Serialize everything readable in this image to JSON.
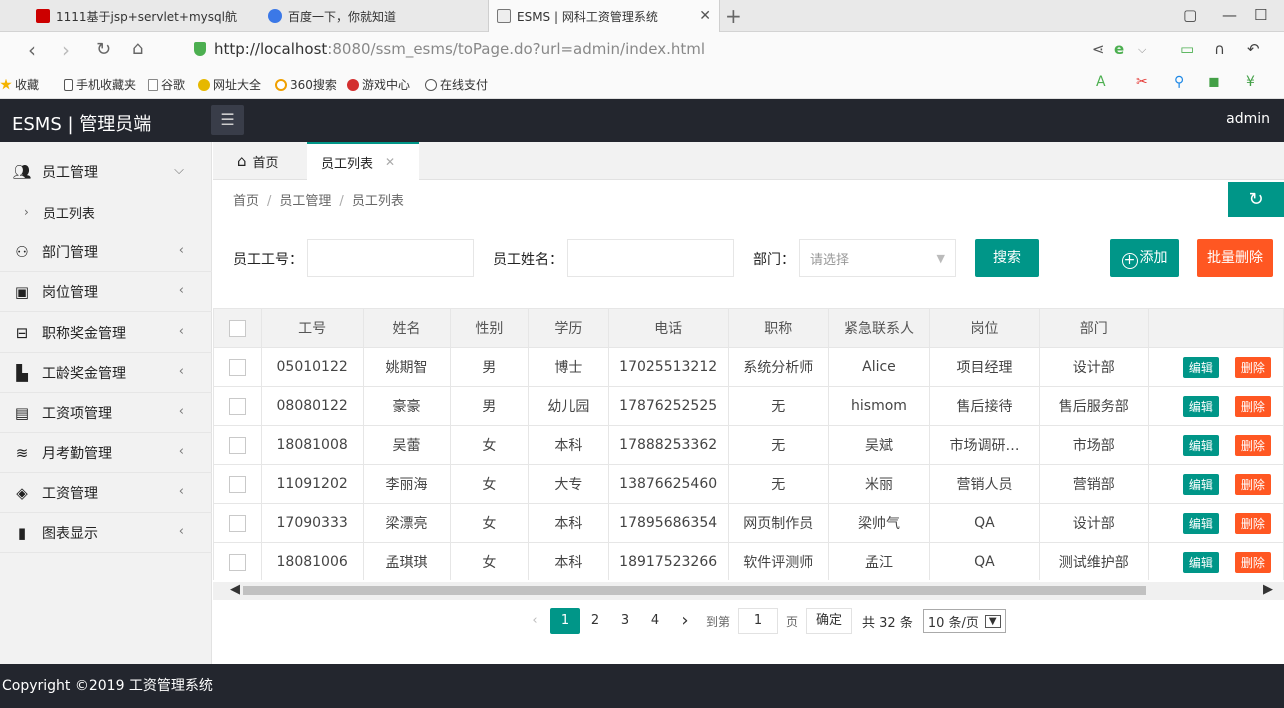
{
  "browser": {
    "tabs": [
      {
        "title": "1111基于jsp+servlet+mysql航",
        "active": false
      },
      {
        "title": "百度一下，你就知道",
        "active": false
      },
      {
        "title": "ESMS | 网科工资管理系统",
        "active": true
      }
    ],
    "url_host": "http://localhost",
    "url_rest": ":8080/ssm_esms/toPage.do?url=admin/index.html",
    "bookmarks": [
      "收藏",
      "手机收藏夹",
      "谷歌",
      "网址大全",
      "360搜索",
      "游戏中心",
      "在线支付"
    ]
  },
  "app": {
    "title": "ESMS | 管理员端",
    "user": "admin",
    "footer": "Copyright ©2019 工资管理系统"
  },
  "sidebar": {
    "items": [
      {
        "label": "员工管理",
        "icon": "users-icon",
        "expanded": true
      },
      {
        "label": "部门管理",
        "icon": "org-chart-icon"
      },
      {
        "label": "岗位管理",
        "icon": "id-card-icon"
      },
      {
        "label": "职称奖金管理",
        "icon": "briefcase-icon"
      },
      {
        "label": "工龄奖金管理",
        "icon": "factory-icon"
      },
      {
        "label": "工资项管理",
        "icon": "salary-item-icon"
      },
      {
        "label": "月考勤管理",
        "icon": "layers-icon"
      },
      {
        "label": "工资管理",
        "icon": "tag-icon"
      },
      {
        "label": "图表显示",
        "icon": "document-icon"
      }
    ],
    "subitems": [
      {
        "label": "员工列表"
      }
    ]
  },
  "page_tabs": [
    {
      "label": "首页"
    },
    {
      "label": "员工列表"
    }
  ],
  "breadcrumb": [
    "首页",
    "员工管理",
    "员工列表"
  ],
  "filters": {
    "emp_no_label": "员工工号：",
    "emp_name_label": "员工姓名：",
    "dept_label": "部门：",
    "dept_placeholder": "请选择",
    "search_label": "搜索",
    "add_label": "添加",
    "batch_delete_label": "批量删除"
  },
  "table": {
    "headers": [
      "工号",
      "姓名",
      "性别",
      "学历",
      "电话",
      "职称",
      "紧急联系人",
      "岗位",
      "部门"
    ],
    "edit_label": "编辑",
    "delete_label": "删除",
    "rows": [
      [
        "05010122",
        "姚期智",
        "男",
        "博士",
        "17025513212",
        "系统分析师",
        "Alice",
        "项目经理",
        "设计部"
      ],
      [
        "08080122",
        "豪豪",
        "男",
        "幼儿园",
        "17876252525",
        "无",
        "hismom",
        "售后接待",
        "售后服务部"
      ],
      [
        "18081008",
        "吴蕾",
        "女",
        "本科",
        "17888253362",
        "无",
        "吴斌",
        "市场调研…",
        "市场部"
      ],
      [
        "11091202",
        "李丽海",
        "女",
        "大专",
        "13876625460",
        "无",
        "米丽",
        "营销人员",
        "营销部"
      ],
      [
        "17090333",
        "梁漂亮",
        "女",
        "本科",
        "17895686354",
        "网页制作员",
        "梁帅气",
        "QA",
        "设计部"
      ],
      [
        "18081006",
        "孟琪琪",
        "女",
        "本科",
        "18917523266",
        "软件评测师",
        "孟江",
        "QA",
        "测试维护部"
      ]
    ]
  },
  "pagination": {
    "pages": [
      "1",
      "2",
      "3",
      "4"
    ],
    "current": "1",
    "goto_label": "到第",
    "goto_value": "1",
    "page_unit": "页",
    "confirm_label": "确定",
    "total": "共 32 条",
    "page_size": "10 条/页"
  },
  "colors": {
    "primary": "#009688",
    "danger": "#ff5722",
    "header": "#23262e"
  }
}
